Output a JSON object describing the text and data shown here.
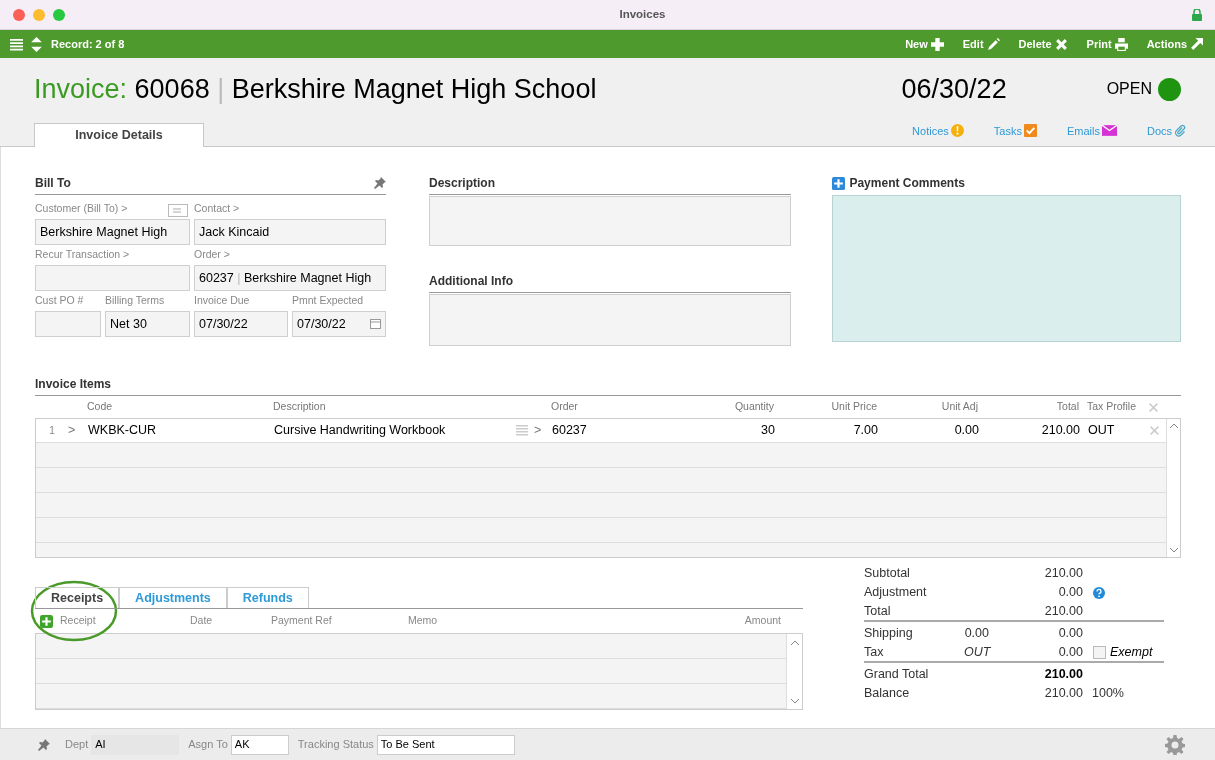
{
  "window": {
    "title": "Invoices"
  },
  "toolbar": {
    "record": "Record: 2 of 8",
    "actions": [
      {
        "label": "New"
      },
      {
        "label": "Edit"
      },
      {
        "label": "Delete"
      },
      {
        "label": "Print"
      },
      {
        "label": "Actions"
      }
    ]
  },
  "header": {
    "prefix": "Invoice:",
    "number": "60068",
    "separator": "|",
    "customer": "Berkshire Magnet High School",
    "date": "06/30/22",
    "status": "OPEN"
  },
  "tabs": [
    {
      "label": "Invoice Details",
      "selected": true
    }
  ],
  "links": [
    {
      "label": "Notices"
    },
    {
      "label": "Tasks"
    },
    {
      "label": "Emails"
    },
    {
      "label": "Docs"
    }
  ],
  "bill_to": {
    "title": "Bill To",
    "rows": [
      [
        {
          "label": "Customer (Bill To) >",
          "value": "Berkshire Magnet High",
          "kind": "card"
        },
        {
          "label": "Contact >",
          "value": "Jack Kincaid",
          "kind": "text"
        }
      ],
      [
        {
          "label": "Recur Transaction >",
          "kind": "text"
        },
        {
          "label": "Order >",
          "value": "60237",
          "separator": "|",
          "value2": "Berkshire Magnet High",
          "kind": "order"
        }
      ],
      [
        {
          "label": "Cust PO #",
          "kind": "text"
        },
        {
          "label": "Billing Terms",
          "value": "Net 30",
          "kind": "text"
        },
        {
          "label": "Invoice Due",
          "value": "07/30/22",
          "kind": "text"
        },
        {
          "label": "Pmnt Expected",
          "value": "07/30/22",
          "kind": "date"
        }
      ]
    ]
  },
  "description": {
    "title": "Description"
  },
  "additional_info": {
    "title": "Additional Info"
  },
  "payment_comments": {
    "title": "Payment Comments"
  },
  "invoice_items": {
    "title": "Invoice Items",
    "columns": [
      "Code",
      "Description",
      "Order",
      "Quantity",
      "Unit Price",
      "Unit Adj",
      "Total",
      "Tax Profile"
    ],
    "rows": [
      {
        "number": "1",
        "arrow": ">",
        "code": "WKBK-CUR",
        "description": "Cursive Handwriting Workbook",
        "order_arrow": ">",
        "order": "60237",
        "quantity": "30",
        "unit_price": "7.00",
        "unit_adj": "0.00",
        "total": "210.00",
        "tax_profile": "OUT"
      }
    ]
  },
  "receipt_tabs": [
    {
      "label": "Receipts",
      "selected": true
    },
    {
      "label": "Adjustments",
      "selected": false
    },
    {
      "label": "Refunds",
      "selected": false
    }
  ],
  "receipts": {
    "columns": [
      "Receipt",
      "Date",
      "Payment Ref",
      "Memo",
      "Amount"
    ]
  },
  "totals": [
    {
      "label": "Subtotal",
      "value": "210.00",
      "kind": "plain",
      "rule_after": false,
      "bold": false
    },
    {
      "label": "Adjustment",
      "value": "0.00",
      "kind": "help",
      "rule_after": false,
      "bold": false
    },
    {
      "label": "Total",
      "value": "210.00",
      "kind": "plain",
      "rule_after": true,
      "bold": false
    },
    {
      "label": "Shipping",
      "rate": "0.00",
      "value": "0.00",
      "kind": "plain",
      "rule_after": false,
      "bold": false
    },
    {
      "label": "Tax",
      "rate": "OUT",
      "value": "0.00",
      "kind": "exempt",
      "note": "Exempt",
      "checked": false,
      "rule_after": true,
      "bold": false
    },
    {
      "label": "Grand Total",
      "value": "210.00",
      "kind": "plain",
      "rule_after": false,
      "bold": true
    },
    {
      "label": "Balance",
      "value": "210.00",
      "kind": "percent",
      "note": "100%",
      "rule_after": false,
      "bold": false
    }
  ],
  "footer": [
    {
      "label": "Dept",
      "value": "AI",
      "kind": "locked"
    },
    {
      "label": "Asgn To",
      "value": "AK",
      "kind": "edit"
    },
    {
      "label": "Tracking Status",
      "value": "To Be Sent",
      "kind": "edit"
    }
  ]
}
